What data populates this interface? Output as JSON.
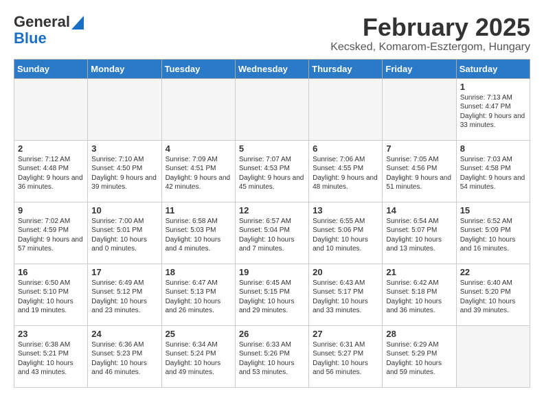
{
  "header": {
    "logo_line1": "General",
    "logo_line2": "Blue",
    "title": "February 2025",
    "subtitle": "Kecsked, Komarom-Esztergom, Hungary"
  },
  "days_of_week": [
    "Sunday",
    "Monday",
    "Tuesday",
    "Wednesday",
    "Thursday",
    "Friday",
    "Saturday"
  ],
  "weeks": [
    [
      {
        "day": "",
        "info": ""
      },
      {
        "day": "",
        "info": ""
      },
      {
        "day": "",
        "info": ""
      },
      {
        "day": "",
        "info": ""
      },
      {
        "day": "",
        "info": ""
      },
      {
        "day": "",
        "info": ""
      },
      {
        "day": "1",
        "info": "Sunrise: 7:13 AM\nSunset: 4:47 PM\nDaylight: 9 hours and 33 minutes."
      }
    ],
    [
      {
        "day": "2",
        "info": "Sunrise: 7:12 AM\nSunset: 4:48 PM\nDaylight: 9 hours and 36 minutes."
      },
      {
        "day": "3",
        "info": "Sunrise: 7:10 AM\nSunset: 4:50 PM\nDaylight: 9 hours and 39 minutes."
      },
      {
        "day": "4",
        "info": "Sunrise: 7:09 AM\nSunset: 4:51 PM\nDaylight: 9 hours and 42 minutes."
      },
      {
        "day": "5",
        "info": "Sunrise: 7:07 AM\nSunset: 4:53 PM\nDaylight: 9 hours and 45 minutes."
      },
      {
        "day": "6",
        "info": "Sunrise: 7:06 AM\nSunset: 4:55 PM\nDaylight: 9 hours and 48 minutes."
      },
      {
        "day": "7",
        "info": "Sunrise: 7:05 AM\nSunset: 4:56 PM\nDaylight: 9 hours and 51 minutes."
      },
      {
        "day": "8",
        "info": "Sunrise: 7:03 AM\nSunset: 4:58 PM\nDaylight: 9 hours and 54 minutes."
      }
    ],
    [
      {
        "day": "9",
        "info": "Sunrise: 7:02 AM\nSunset: 4:59 PM\nDaylight: 9 hours and 57 minutes."
      },
      {
        "day": "10",
        "info": "Sunrise: 7:00 AM\nSunset: 5:01 PM\nDaylight: 10 hours and 0 minutes."
      },
      {
        "day": "11",
        "info": "Sunrise: 6:58 AM\nSunset: 5:03 PM\nDaylight: 10 hours and 4 minutes."
      },
      {
        "day": "12",
        "info": "Sunrise: 6:57 AM\nSunset: 5:04 PM\nDaylight: 10 hours and 7 minutes."
      },
      {
        "day": "13",
        "info": "Sunrise: 6:55 AM\nSunset: 5:06 PM\nDaylight: 10 hours and 10 minutes."
      },
      {
        "day": "14",
        "info": "Sunrise: 6:54 AM\nSunset: 5:07 PM\nDaylight: 10 hours and 13 minutes."
      },
      {
        "day": "15",
        "info": "Sunrise: 6:52 AM\nSunset: 5:09 PM\nDaylight: 10 hours and 16 minutes."
      }
    ],
    [
      {
        "day": "16",
        "info": "Sunrise: 6:50 AM\nSunset: 5:10 PM\nDaylight: 10 hours and 19 minutes."
      },
      {
        "day": "17",
        "info": "Sunrise: 6:49 AM\nSunset: 5:12 PM\nDaylight: 10 hours and 23 minutes."
      },
      {
        "day": "18",
        "info": "Sunrise: 6:47 AM\nSunset: 5:13 PM\nDaylight: 10 hours and 26 minutes."
      },
      {
        "day": "19",
        "info": "Sunrise: 6:45 AM\nSunset: 5:15 PM\nDaylight: 10 hours and 29 minutes."
      },
      {
        "day": "20",
        "info": "Sunrise: 6:43 AM\nSunset: 5:17 PM\nDaylight: 10 hours and 33 minutes."
      },
      {
        "day": "21",
        "info": "Sunrise: 6:42 AM\nSunset: 5:18 PM\nDaylight: 10 hours and 36 minutes."
      },
      {
        "day": "22",
        "info": "Sunrise: 6:40 AM\nSunset: 5:20 PM\nDaylight: 10 hours and 39 minutes."
      }
    ],
    [
      {
        "day": "23",
        "info": "Sunrise: 6:38 AM\nSunset: 5:21 PM\nDaylight: 10 hours and 43 minutes."
      },
      {
        "day": "24",
        "info": "Sunrise: 6:36 AM\nSunset: 5:23 PM\nDaylight: 10 hours and 46 minutes."
      },
      {
        "day": "25",
        "info": "Sunrise: 6:34 AM\nSunset: 5:24 PM\nDaylight: 10 hours and 49 minutes."
      },
      {
        "day": "26",
        "info": "Sunrise: 6:33 AM\nSunset: 5:26 PM\nDaylight: 10 hours and 53 minutes."
      },
      {
        "day": "27",
        "info": "Sunrise: 6:31 AM\nSunset: 5:27 PM\nDaylight: 10 hours and 56 minutes."
      },
      {
        "day": "28",
        "info": "Sunrise: 6:29 AM\nSunset: 5:29 PM\nDaylight: 10 hours and 59 minutes."
      },
      {
        "day": "",
        "info": ""
      }
    ]
  ]
}
